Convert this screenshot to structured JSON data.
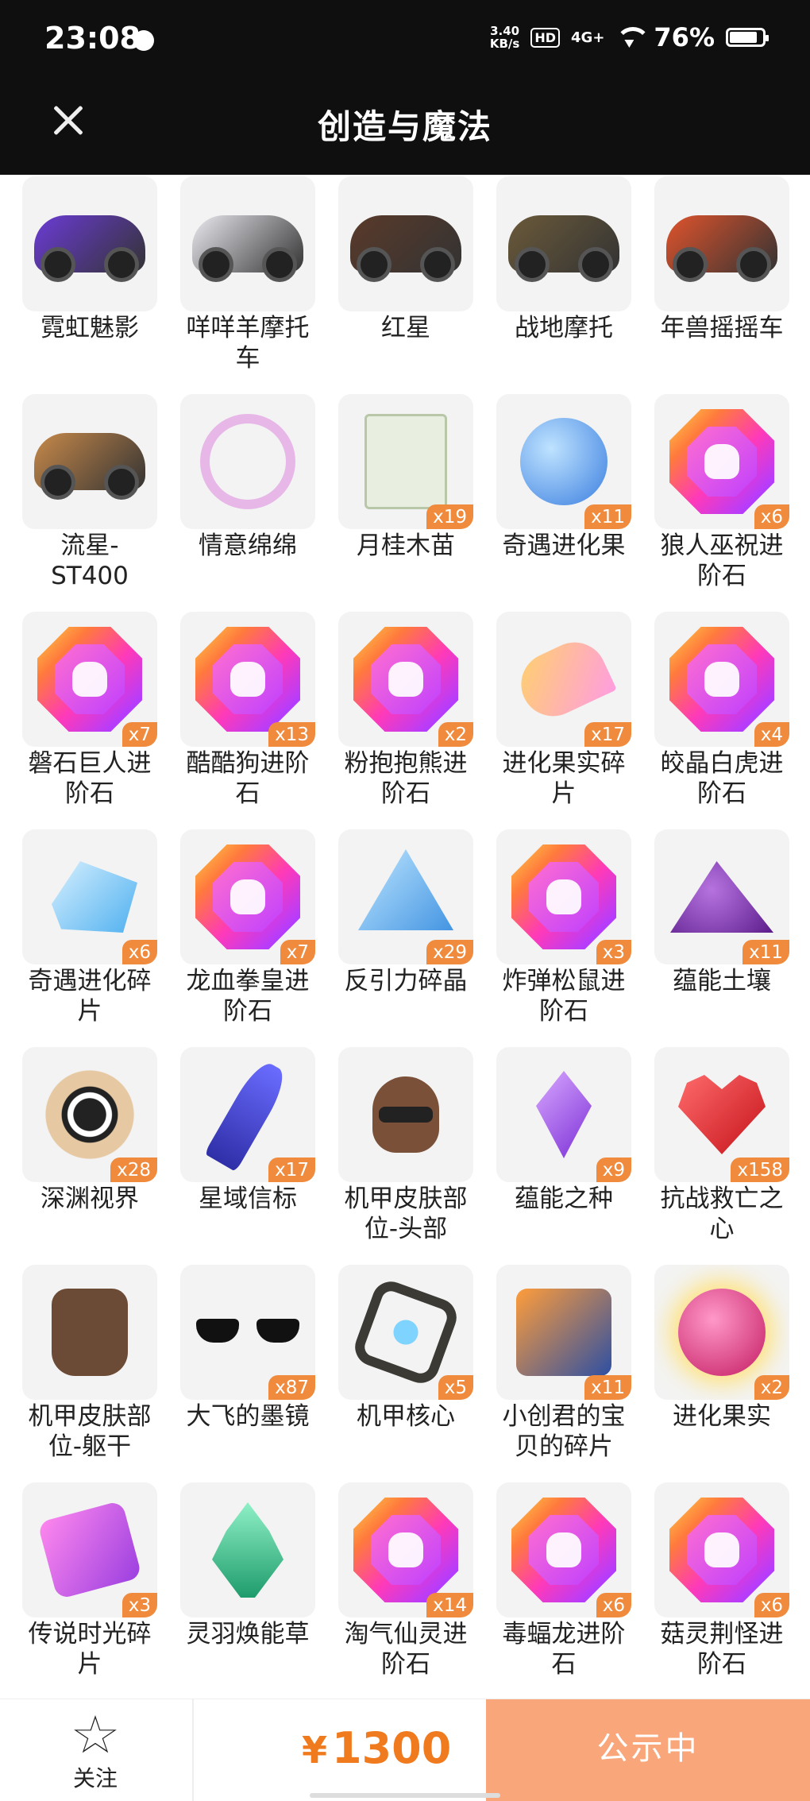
{
  "status_bar": {
    "time": "23:08",
    "net_speed_value": "3.40",
    "net_speed_unit": "KB/s",
    "hd": "HD",
    "network": "4G+",
    "battery": "76%"
  },
  "header": {
    "title": "创造与魔法",
    "close_icon": "close-icon"
  },
  "items": [
    {
      "name": "霓虹魅影",
      "qty": "",
      "icon": "vehicle",
      "color": "#6b3bd6"
    },
    {
      "name": "咩咩羊摩托车",
      "qty": "",
      "icon": "vehicle",
      "color": "#e9e9ef"
    },
    {
      "name": "红星",
      "qty": "",
      "icon": "vehicle",
      "color": "#5a3a2a"
    },
    {
      "name": "战地摩托",
      "qty": "",
      "icon": "vehicle",
      "color": "#6b5a3a"
    },
    {
      "name": "年兽摇摇车",
      "qty": "",
      "icon": "vehicle",
      "color": "#e0532c"
    },
    {
      "name": "流星-ST400",
      "qty": "",
      "icon": "vehicle",
      "color": "#c7894a"
    },
    {
      "name": "情意绵绵",
      "qty": "",
      "icon": "wreath",
      "color": "#e7b7e8"
    },
    {
      "name": "月桂木苗",
      "qty": "x19",
      "icon": "bag",
      "color": "#e8efe0"
    },
    {
      "name": "奇遇进化果",
      "qty": "x11",
      "icon": "berry",
      "color": "#3b7fe0"
    },
    {
      "name": "狼人巫祝进阶石",
      "qty": "x6",
      "icon": "gem",
      "color": "#ff3ab8"
    },
    {
      "name": "磐石巨人进阶石",
      "qty": "x7",
      "icon": "gem",
      "color": "#ff3ab8"
    },
    {
      "name": "酷酷狗进阶石",
      "qty": "x13",
      "icon": "gem",
      "color": "#ff3ab8"
    },
    {
      "name": "粉抱抱熊进阶石",
      "qty": "x2",
      "icon": "gem",
      "color": "#ff3ab8"
    },
    {
      "name": "进化果实碎片",
      "qty": "x17",
      "icon": "slice",
      "color": "#ffd26b"
    },
    {
      "name": "皎晶白虎进阶石",
      "qty": "x4",
      "icon": "gem",
      "color": "#ff3ab8"
    },
    {
      "name": "奇遇进化碎片",
      "qty": "x6",
      "icon": "crystal",
      "color": "#4fb0f0"
    },
    {
      "name": "龙血拳皇进阶石",
      "qty": "x7",
      "icon": "gem",
      "color": "#ff3ab8"
    },
    {
      "name": "反引力碎晶",
      "qty": "x29",
      "icon": "tri",
      "color": "#3a8ee0"
    },
    {
      "name": "炸弹松鼠进阶石",
      "qty": "x3",
      "icon": "gem",
      "color": "#ff3ab8"
    },
    {
      "name": "蕴能土壤",
      "qty": "x11",
      "icon": "soil",
      "color": "#7b2fd6"
    },
    {
      "name": "深渊视界",
      "qty": "x28",
      "icon": "sun",
      "color": "#e6c9a3"
    },
    {
      "name": "星域信标",
      "qty": "x17",
      "icon": "spear",
      "color": "#4a4cd8"
    },
    {
      "name": "机甲皮肤部位-头部",
      "qty": "",
      "icon": "head",
      "color": "#7a5038"
    },
    {
      "name": "蕴能之种",
      "qty": "x9",
      "icon": "seed",
      "color": "#9b4fe0"
    },
    {
      "name": "抗战救亡之心",
      "qty": "x158",
      "icon": "heart",
      "color": "#e0242c"
    },
    {
      "name": "机甲皮肤部位-躯干",
      "qty": "",
      "icon": "torso",
      "color": "#6b4a36"
    },
    {
      "name": "大飞的墨镜",
      "qty": "x87",
      "icon": "glasses",
      "color": "#111111"
    },
    {
      "name": "机甲核心",
      "qty": "x5",
      "icon": "core",
      "color": "#3b3a35"
    },
    {
      "name": "小创君的宝贝的碎片",
      "qty": "x11",
      "icon": "puzzle",
      "color": "#ff9d3a"
    },
    {
      "name": "进化果实",
      "qty": "x2",
      "icon": "rasp",
      "color": "#c41b62"
    },
    {
      "name": "传说时光碎片",
      "qty": "x3",
      "icon": "tpuzzle",
      "color": "#c25ef0"
    },
    {
      "name": "灵羽焕能草",
      "qty": "",
      "icon": "leaf",
      "color": "#2fb37c"
    },
    {
      "name": "淘气仙灵进阶石",
      "qty": "x14",
      "icon": "gem",
      "color": "#ff3ab8"
    },
    {
      "name": "毒蝠龙进阶石",
      "qty": "x6",
      "icon": "gem",
      "color": "#ff3ab8"
    },
    {
      "name": "菇灵荆怪进阶石",
      "qty": "x6",
      "icon": "gem",
      "color": "#ff3ab8"
    }
  ],
  "bottom_bar": {
    "follow_label": "关注",
    "follow_icon": "star-icon",
    "currency": "¥",
    "price": "1300",
    "status_button": "公示中"
  },
  "colors": {
    "accent": "#f07a1e",
    "qty_badge": "#f08a3c",
    "status_button_bg": "#f9a77a",
    "header_bg": "#0f0f0f"
  }
}
